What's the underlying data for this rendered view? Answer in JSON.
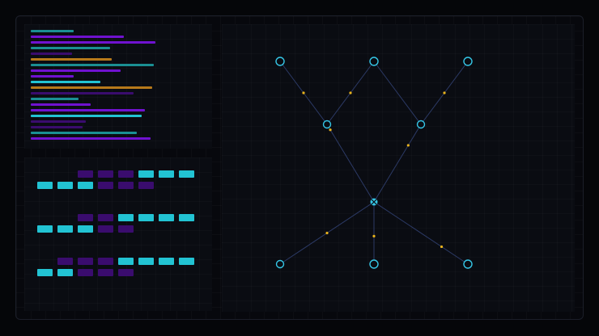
{
  "colors": {
    "cyan": "#22c3d3",
    "teal": "#1a8f93",
    "purple": "#7012d0",
    "dark_purple": "#3a0c6e",
    "amber": "#b7791a",
    "node_stroke": "#35c6e6",
    "edge": "#2c3a66",
    "dot": "#e8b21c"
  },
  "code_lines": [
    {
      "w": 0.26,
      "c": "teal"
    },
    {
      "w": 0.56,
      "c": "purple"
    },
    {
      "w": 0.75,
      "c": "purple"
    },
    {
      "w": 0.48,
      "c": "teal"
    },
    {
      "w": 0.25,
      "c": "dark_purple"
    },
    {
      "w": 0.49,
      "c": "amber"
    },
    {
      "w": 0.74,
      "c": "teal"
    },
    {
      "w": 0.54,
      "c": "purple"
    },
    {
      "w": 0.26,
      "c": "purple"
    },
    {
      "w": 0.42,
      "c": "cyan"
    },
    {
      "w": 0.73,
      "c": "amber"
    },
    {
      "w": 0.62,
      "c": "dark_purple"
    },
    {
      "w": 0.29,
      "c": "teal"
    },
    {
      "w": 0.36,
      "c": "purple"
    },
    {
      "w": 0.69,
      "c": "purple"
    },
    {
      "w": 0.67,
      "c": "cyan"
    },
    {
      "w": 0.33,
      "c": "dark_purple"
    },
    {
      "w": 0.31,
      "c": "dark_purple"
    },
    {
      "w": 0.64,
      "c": "teal"
    },
    {
      "w": 0.72,
      "c": "purple"
    }
  ],
  "block_groups": [
    {
      "top": [
        "dark_purple",
        "dark_purple",
        "dark_purple",
        "cyan",
        "cyan",
        "cyan"
      ],
      "bottom": [
        "cyan",
        "cyan",
        "cyan",
        "dark_purple",
        "dark_purple",
        "dark_purple"
      ]
    },
    {
      "top": [
        "dark_purple",
        "dark_purple",
        "cyan",
        "cyan",
        "cyan",
        "cyan"
      ],
      "bottom": [
        "cyan",
        "cyan",
        "cyan",
        "dark_purple",
        "dark_purple"
      ]
    },
    {
      "top": [
        "dark_purple",
        "dark_purple",
        "dark_purple",
        "cyan",
        "cyan",
        "cyan",
        "cyan"
      ],
      "bottom": [
        "cyan",
        "cyan",
        "dark_purple",
        "dark_purple",
        "dark_purple"
      ]
    }
  ],
  "graph": {
    "nodes": [
      {
        "id": "top-left",
        "kind": "ring"
      },
      {
        "id": "top-center",
        "kind": "ring"
      },
      {
        "id": "top-right",
        "kind": "ring"
      },
      {
        "id": "mid-left",
        "kind": "ring-small"
      },
      {
        "id": "mid-right",
        "kind": "ring-small"
      },
      {
        "id": "hub",
        "kind": "hub"
      },
      {
        "id": "bottom-left",
        "kind": "ring-small"
      },
      {
        "id": "bottom-center",
        "kind": "ring"
      },
      {
        "id": "bottom-right",
        "kind": "ring"
      }
    ],
    "edges": [
      {
        "from": "top-left",
        "to": "mid-left",
        "dot": 0.5
      },
      {
        "from": "top-center",
        "to": "mid-left",
        "dot": 0.5
      },
      {
        "from": "top-right",
        "to": "mid-right",
        "dot": 0.5
      },
      {
        "from": "top-center",
        "to": "mid-right",
        "dot": null
      },
      {
        "from": "mid-left",
        "to": "hub",
        "dot": 0.07
      },
      {
        "from": "mid-right",
        "to": "hub",
        "dot": 0.27
      },
      {
        "from": "hub",
        "to": "bottom-left",
        "dot": 0.5
      },
      {
        "from": "hub",
        "to": "bottom-center",
        "dot": 0.55
      },
      {
        "from": "hub",
        "to": "bottom-right",
        "dot": 0.72
      }
    ]
  }
}
